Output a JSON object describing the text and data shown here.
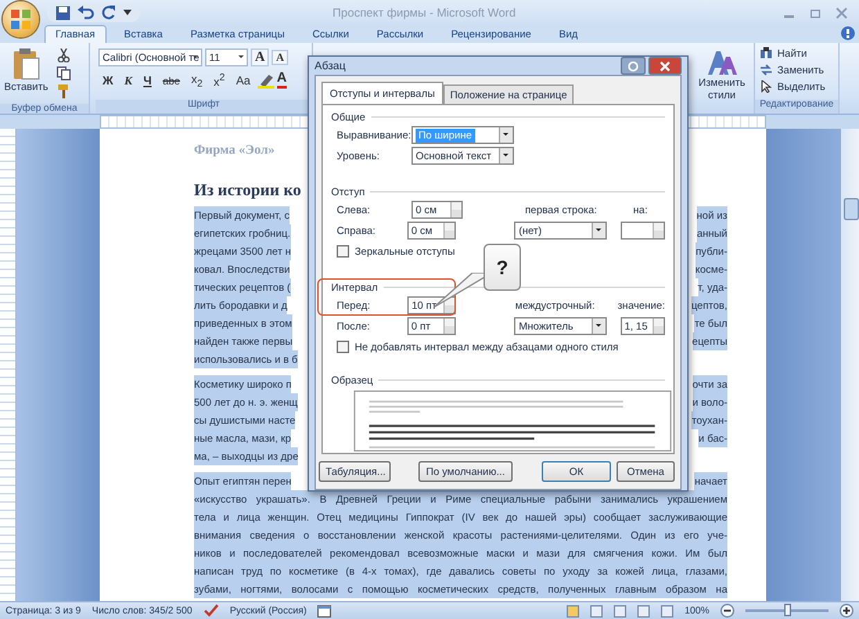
{
  "window": {
    "title": "Проспект фирмы - Microsoft Word"
  },
  "ribbon_tabs": [
    {
      "label": "Главная",
      "selected": true
    },
    {
      "label": "Вставка",
      "selected": false
    },
    {
      "label": "Разметка страницы",
      "selected": false
    },
    {
      "label": "Ссылки",
      "selected": false
    },
    {
      "label": "Рассылки",
      "selected": false
    },
    {
      "label": "Рецензирование",
      "selected": false
    },
    {
      "label": "Вид",
      "selected": false
    }
  ],
  "ribbon": {
    "clipboard": {
      "paste": "Вставить",
      "group": "Буфер обмена"
    },
    "font": {
      "family": "Calibri (Основной те",
      "size": "11",
      "group": "Шрифт",
      "size_buttons": [
        {
          "kind": "grow",
          "label": "A"
        },
        {
          "kind": "shrink",
          "label": "A"
        }
      ],
      "format_buttons": [
        {
          "kind": "bold",
          "label": "Ж"
        },
        {
          "kind": "italic",
          "label": "К"
        },
        {
          "kind": "underline",
          "label": "Ч"
        },
        {
          "kind": "strike",
          "label": "abe"
        },
        {
          "kind": "plain",
          "label": "x$_{2}$"
        },
        {
          "kind": "plain",
          "label": "x$^{2}$"
        },
        {
          "kind": "plain",
          "label": "Aa"
        }
      ],
      "color_label": "A"
    },
    "styles": {
      "change": "Изменить стили"
    },
    "editing": {
      "group": "Редактирование",
      "items": [
        {
          "kind": "find",
          "label": "Найти"
        },
        {
          "kind": "replace",
          "label": "Заменить"
        },
        {
          "kind": "select",
          "label": "Выделить"
        }
      ]
    }
  },
  "document": {
    "company": "Фирма «Эол»",
    "heading": "Из истории ко",
    "paragraphs": [
      {
        "selected": true,
        "lines": [
          {
            "left": "Первый документ, с",
            "right": "ной из"
          },
          {
            "left": "египетских гробниц.",
            "right": "анный"
          },
          {
            "left": "жрецами 3500 лет н",
            "right": "публи-"
          },
          {
            "left": "ковал. Впоследстви",
            "right": "косме-"
          },
          {
            "left": "тических рецептов (",
            "right": "т, уда-"
          },
          {
            "left": "лить бородавки и д",
            "right": "цептов,"
          },
          {
            "left": "приведенных в этом",
            "right": "те был"
          },
          {
            "left": "найден также первы",
            "right": "ецепты"
          },
          {
            "left": "использовались и в б"
          }
        ]
      },
      {
        "selected": true,
        "lines": [
          {
            "left": "Косметику широко п",
            "right": "очти за"
          },
          {
            "left": "500 лет до н. э. женщ",
            "right": "и воло-"
          },
          {
            "left": "сы душистыми насте",
            "right": "тоухан-"
          },
          {
            "left": "ные масла, мази, кр",
            "right": "и бас-"
          },
          {
            "left": "ма, – выходцы из дре"
          }
        ]
      },
      {
        "selected": true,
        "lines": [
          {
            "left": "Опыт египтян перен",
            "right": "начает"
          },
          {
            "text": "«искусство украшать». В Древней Греции и Риме специальные рабыни занимались украшением"
          },
          {
            "text": "тела и лица женщин. Отец медицины Гиппократ (IV век до нашей эры) сообщает заслуживающие"
          },
          {
            "text": "внимания сведения о восстановлении женской красоты растениями-целителями. Один из его уче-"
          },
          {
            "text": "ников и последователей рекомендовал всевозможные маски и мази для смягчения кожи. Им был"
          },
          {
            "text": "написан труд по косметике (в 4-х томах), где давались советы по уходу за кожей лица, глазами,"
          },
          {
            "text": "зубами, ногтями, волосами с помощью косметических средств, полученных главным образом на"
          }
        ]
      }
    ]
  },
  "dialog": {
    "title": "Абзац",
    "tabs": [
      {
        "label": "Отступы и интервалы",
        "selected": true
      },
      {
        "label": "Положение на странице",
        "selected": false
      }
    ],
    "general": {
      "legend": "Общие",
      "alignment": {
        "label": "Выравнивание:",
        "value": "По ширине"
      },
      "level": {
        "label": "Уровень:",
        "value": "Основной текст"
      }
    },
    "indent": {
      "legend": "Отступ",
      "left": {
        "label": "Слева:",
        "value": "0 см"
      },
      "right": {
        "label": "Справа:",
        "value": "0 см"
      },
      "first_line": {
        "label": "первая строка:",
        "value": "(нет)"
      },
      "by": {
        "label": "на:"
      },
      "mirror": {
        "label": "Зеркальные отступы",
        "checked": false
      }
    },
    "spacing": {
      "legend": "Интервал",
      "before": {
        "label": "Перед:",
        "value": "10 пт"
      },
      "after": {
        "label": "После:",
        "value": "0 пт"
      },
      "line": {
        "label": "междустрочный:",
        "value": "Множитель"
      },
      "at": {
        "label": "значение:",
        "value": "1, 15"
      },
      "no_space": {
        "label": "Не добавлять интервал между абзацами одного стиля",
        "checked": false
      }
    },
    "preview": {
      "legend": "Образец"
    },
    "callout": "?",
    "buttons": [
      {
        "kind": "tabs",
        "label": "Табуляция..."
      },
      {
        "kind": "default",
        "label": "По умолчанию..."
      },
      {
        "kind": "ok",
        "label": "ОК"
      },
      {
        "kind": "cancel",
        "label": "Отмена"
      }
    ]
  },
  "status_bar": {
    "page": "Страница: 3 из 9",
    "words": "Число слов: 345/2 500",
    "language": "Русский (Россия)",
    "zoom": "100%",
    "zoom_level": {
      "level": 0.5
    }
  }
}
